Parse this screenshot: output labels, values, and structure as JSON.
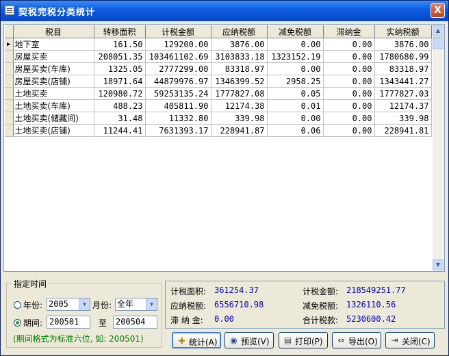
{
  "window": {
    "title": "契税完税分类统计",
    "close_symbol": "X"
  },
  "grid": {
    "headers": [
      "税目",
      "转移面积",
      "计税金额",
      "应纳税额",
      "减免税额",
      "滞纳金",
      "实纳税额"
    ],
    "current_row_marker": "▶",
    "rows": [
      [
        "地下室",
        "161.50",
        "129200.00",
        "3876.00",
        "0.00",
        "0.00",
        "3876.00"
      ],
      [
        "房屋买卖",
        "208051.35",
        "103461102.69",
        "3103833.18",
        "1323152.19",
        "0.00",
        "1780680.99"
      ],
      [
        "房屋买卖(车库)",
        "1325.05",
        "2777299.00",
        "83318.97",
        "0.00",
        "0.00",
        "83318.97"
      ],
      [
        "房屋买卖(店铺)",
        "18971.64",
        "44879976.97",
        "1346399.52",
        "2958.25",
        "0.00",
        "1343441.27"
      ],
      [
        "土地买卖",
        "120980.72",
        "59253135.24",
        "1777827.08",
        "0.05",
        "0.00",
        "1777827.03"
      ],
      [
        "土地买卖(车库)",
        "488.23",
        "405811.90",
        "12174.38",
        "0.01",
        "0.00",
        "12174.37"
      ],
      [
        "土地买卖(储藏间)",
        "31.48",
        "11332.80",
        "339.98",
        "0.00",
        "0.00",
        "339.98"
      ],
      [
        "土地买卖(店铺)",
        "11244.41",
        "7631393.17",
        "228941.87",
        "0.06",
        "0.00",
        "228941.81"
      ]
    ]
  },
  "time_filter": {
    "legend": "指定时间",
    "year_label": "年份:",
    "year_value": "2005",
    "month_label": "月份:",
    "month_value": "全年",
    "period_label": "期间:",
    "period_from": "200501",
    "period_to_label": "至",
    "period_to": "200504",
    "hint": "(期间格式为标准六位, 如: 200501)",
    "selected": "period"
  },
  "summary": {
    "area_label": "计税面积:",
    "area_value": "361254.37",
    "amount_label": "计税金额:",
    "amount_value": "218549251.77",
    "payable_label": "应纳税额:",
    "payable_value": "6556710.98",
    "exempt_label": "减免税额:",
    "exempt_value": "1326110.56",
    "late_fee_label": "滞 纳 金:",
    "late_fee_value": "0.00",
    "total_label": "合计税款:",
    "total_value": "5230600.42"
  },
  "buttons": {
    "stats": "统计(A)",
    "preview": "预览(V)",
    "print": "打印(P)",
    "export": "导出(O)",
    "close": "关闭(C)"
  },
  "icons": {
    "stats": "calculator-icon",
    "preview": "magnifier-icon",
    "print": "printer-icon",
    "export": "export-arrows-icon",
    "close": "exit-door-icon"
  }
}
